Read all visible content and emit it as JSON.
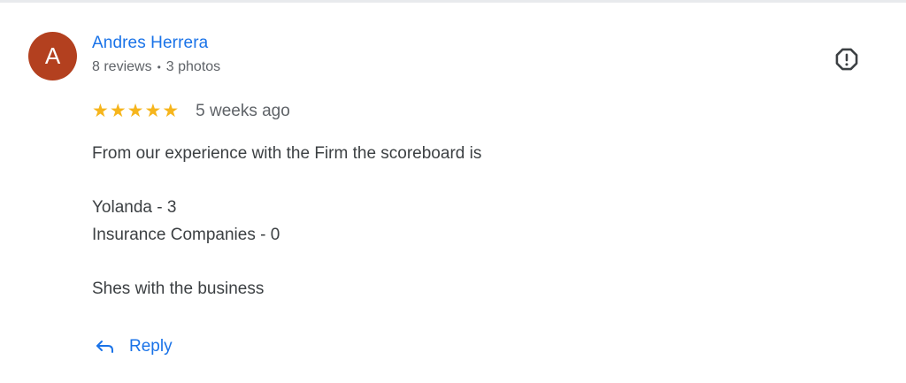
{
  "review": {
    "author": {
      "initial": "A",
      "name": "Andres Herrera",
      "reviews": "8 reviews",
      "separator": "•",
      "photos": "3 photos",
      "avatar_color": "#b3401f"
    },
    "rating": 5,
    "date": "5 weeks ago",
    "text_lines": [
      "From our experience with the Firm the scoreboard is",
      "",
      "Yolanda - 3",
      "Insurance Companies - 0",
      "",
      "Shes with the business"
    ],
    "reply_label": "Reply",
    "icons": {
      "flag": "report-flag-icon",
      "reply": "reply-arrow-icon",
      "star": "star-icon"
    },
    "colors": {
      "accent": "#1a73e8",
      "star": "#f6b51c",
      "text": "#3c4043",
      "muted": "#5f6368"
    }
  }
}
